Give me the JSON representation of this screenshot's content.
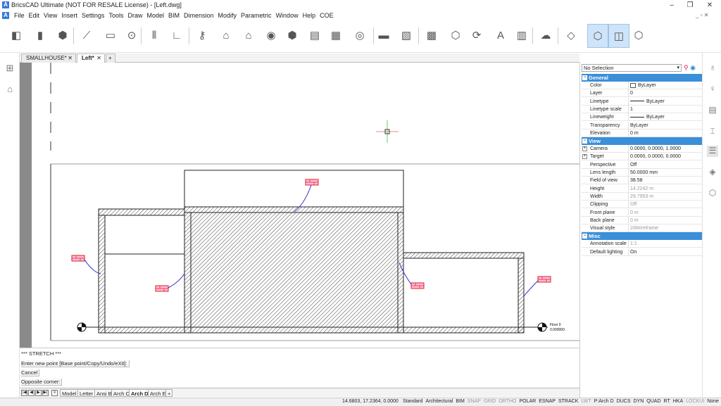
{
  "window": {
    "title": "BricsCAD Ultimate (NOT FOR RESALE License) - [Left.dwg]",
    "minimize": "–",
    "restore": "❐",
    "close": "✕"
  },
  "menu": [
    "File",
    "Edit",
    "View",
    "Insert",
    "Settings",
    "Tools",
    "Draw",
    "Model",
    "BIM",
    "Dimension",
    "Modify",
    "Parametric",
    "Window",
    "Help",
    "COE"
  ],
  "toolbar": {
    "icons": [
      "cube-solid-icon",
      "extrude-icon",
      "box-icon",
      "line-icon",
      "rectangle-icon",
      "polyline-icon",
      "wall-icon",
      "column-icon",
      "building-lock-icon",
      "house-icon",
      "house-classify-icon",
      "audio-icon",
      "house-3d-icon",
      "elevation-icon",
      "grid-icon",
      "sphere-icon",
      "slab-icon",
      "terrain-icon",
      "section-icon",
      "view-cube-icon",
      "spatial-icon",
      "text-export-icon",
      "report-icon",
      "cloud-upload-icon",
      "visual-style-wireframe-icon",
      "visual-style-shaded-icon",
      "visual-style-hidden-icon",
      "view-3d-icon"
    ]
  },
  "doc_tabs": [
    {
      "label": "SMALLHOUSE*",
      "active": false
    },
    {
      "label": "Left*",
      "active": true
    }
  ],
  "new_tab_label": "+",
  "drawing": {
    "floor_label_right": "Floor 0",
    "floor_elev_right": "0.000000"
  },
  "command": {
    "lines": [
      "*** STRETCH ***",
      "Enter new point [Base point/Copy/Undo/eXit]:",
      "Cancel",
      "Opposite corner:"
    ]
  },
  "layout_tabs": [
    "Model",
    "Letter",
    "Ansi B",
    "Arch C",
    "Arch D",
    "Arch E"
  ],
  "layout_active": "Arch D",
  "status": {
    "coords": "14.6803, 17.2364, 0.0000",
    "items": [
      {
        "label": "Standard",
        "on": true
      },
      {
        "label": "Architectural",
        "on": true
      },
      {
        "label": "BIM",
        "on": true
      },
      {
        "label": "SNAP",
        "on": false
      },
      {
        "label": "GRID",
        "on": false
      },
      {
        "label": "ORTHO",
        "on": false
      },
      {
        "label": "POLAR",
        "on": true
      },
      {
        "label": "ESNAP",
        "on": true
      },
      {
        "label": "STRACK",
        "on": true
      },
      {
        "label": "LWT",
        "on": false
      },
      {
        "label": "P:Arch D",
        "on": true
      },
      {
        "label": "DUCS",
        "on": true
      },
      {
        "label": "DYN",
        "on": true
      },
      {
        "label": "QUAD",
        "on": true
      },
      {
        "label": "RT",
        "on": true
      },
      {
        "label": "HKA",
        "on": true
      },
      {
        "label": "LOCKUI",
        "on": false
      },
      {
        "label": "None",
        "on": true
      }
    ]
  },
  "properties": {
    "selection": "No Selection",
    "sections": [
      {
        "title": "General",
        "rows": [
          {
            "key": "Color",
            "value": "ByLayer",
            "swatch": "color"
          },
          {
            "key": "Layer",
            "value": "0"
          },
          {
            "key": "Linetype",
            "value": "ByLayer",
            "swatch": "line"
          },
          {
            "key": "Linetype scale",
            "value": "1"
          },
          {
            "key": "Lineweight",
            "value": "ByLayer",
            "swatch": "line"
          },
          {
            "key": "Transparency",
            "value": "ByLayer"
          },
          {
            "key": "Elevation",
            "value": "0 m"
          }
        ]
      },
      {
        "title": "View",
        "rows": [
          {
            "key": "Camera",
            "value": "0.0000, 0.0000, 1.0000",
            "expand": true
          },
          {
            "key": "Target",
            "value": "0.0000, 0.0000, 0.0000",
            "expand": true
          },
          {
            "key": "Perspective",
            "value": "Off"
          },
          {
            "key": "Lens length",
            "value": "50.0000 mm"
          },
          {
            "key": "Field of view",
            "value": "38.58"
          },
          {
            "key": "Height",
            "value": "14.2242 m",
            "readonly": true
          },
          {
            "key": "Width",
            "value": "29.7953 m",
            "readonly": true
          },
          {
            "key": "Clipping",
            "value": "Off",
            "readonly": true
          },
          {
            "key": "Front plane",
            "value": "0 m",
            "readonly": true
          },
          {
            "key": "Back plane",
            "value": "0 m",
            "readonly": true
          },
          {
            "key": "Visual style",
            "value": "2dWireframe",
            "readonly": true
          }
        ]
      },
      {
        "title": "Misc",
        "rows": [
          {
            "key": "Annotation scale",
            "value": "1:1",
            "readonly": true
          },
          {
            "key": "Default lighting",
            "value": "On"
          }
        ]
      }
    ]
  }
}
